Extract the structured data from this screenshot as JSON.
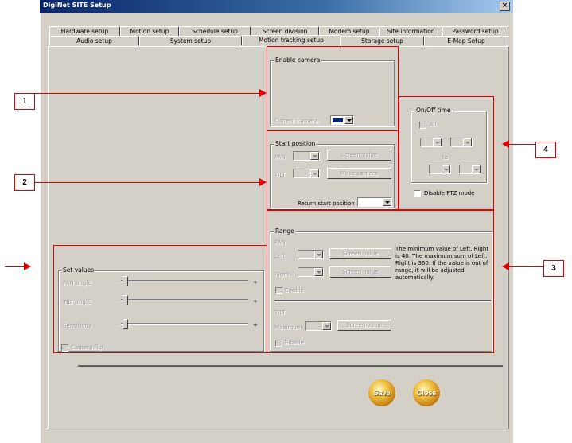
{
  "window": {
    "title": "DigiNet SITE Setup",
    "close": "×"
  },
  "tabs_row1": [
    "Hardware setup",
    "Motion setup",
    "Schedule setup",
    "Screen division",
    "Modem setup",
    "Site information",
    "Password setup"
  ],
  "tabs_row2": [
    "Audio setup",
    "System setup",
    "Motion tracking setup",
    "Storage setup",
    "E-Map Setup"
  ],
  "enable_camera": {
    "legend": "Enable camera",
    "current_camera_label": "Current camera"
  },
  "start_position": {
    "legend": "Start position",
    "pan": "PAN",
    "tilt": "TILT",
    "screen_value": "Screen value",
    "move_camera": "Move camera",
    "return_label": "Return start position"
  },
  "onoff": {
    "legend": "On/Off time",
    "all": "All",
    "to": "to",
    "sep1": ":",
    "sep2": ":",
    "disable_ptz": "Disable PTZ mode"
  },
  "range": {
    "legend": "Range",
    "pan": "PAN",
    "left": "Left",
    "right": "Right",
    "screen_value_1": "Screen value",
    "screen_value_2": "Screen value",
    "enable_1": "Enable",
    "note": "The minimum value of Left, Right is 40. The maximum sum of Left, Right is 360. If the value is out of range, it will be adjusted automatically.",
    "tilt": "TILT",
    "maximum": "Maximum",
    "screen_value_3": "Screen value",
    "enable_2": "Enable"
  },
  "set_values": {
    "legend": "Set values",
    "pan_angle": "PAN angle",
    "tilt_angle": "TILT angle",
    "sensitivity": "Sensitivity",
    "minus": "-",
    "plus": "+",
    "camera_flip": "Camera flip"
  },
  "buttons": {
    "save": "Save",
    "close": "Close"
  },
  "callouts": {
    "c1": "1",
    "c2": "2",
    "c3": "3",
    "c4": "4"
  },
  "colors": {
    "annotation": "#e00000",
    "titlebar": "#0a246a",
    "face": "#d4d0c8"
  }
}
